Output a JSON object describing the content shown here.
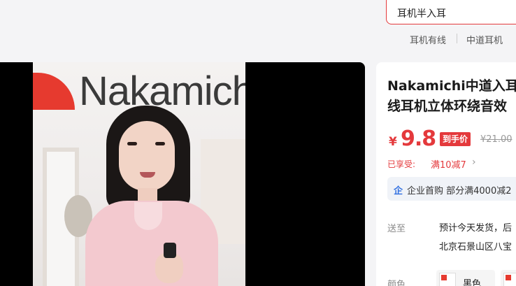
{
  "search": {
    "query": "耳机半入耳"
  },
  "hot_keywords": [
    "耳机有线",
    "中道耳机"
  ],
  "media": {
    "brand_text": "Nakamichi"
  },
  "product": {
    "title_lines": [
      "Nakamichi中道入耳",
      "线耳机立体环绕音效"
    ],
    "currency": "¥",
    "price": "9.8",
    "price_badge": "到手价",
    "original_price": "¥21.00",
    "promo_label": "已享受:",
    "promo_value": "满10减7",
    "enterprise_icon": "企",
    "enterprise_text": "企业首购 部分满4000减2",
    "shipping_label": "送至",
    "shipping_line1": "预计今天发货，后",
    "shipping_line2": "北京石景山区八宝",
    "color_label": "颜色",
    "color_options": [
      "黑色",
      ""
    ]
  },
  "colors": {
    "accent": "#e4393c",
    "enterprise": "#2f6fe0"
  }
}
